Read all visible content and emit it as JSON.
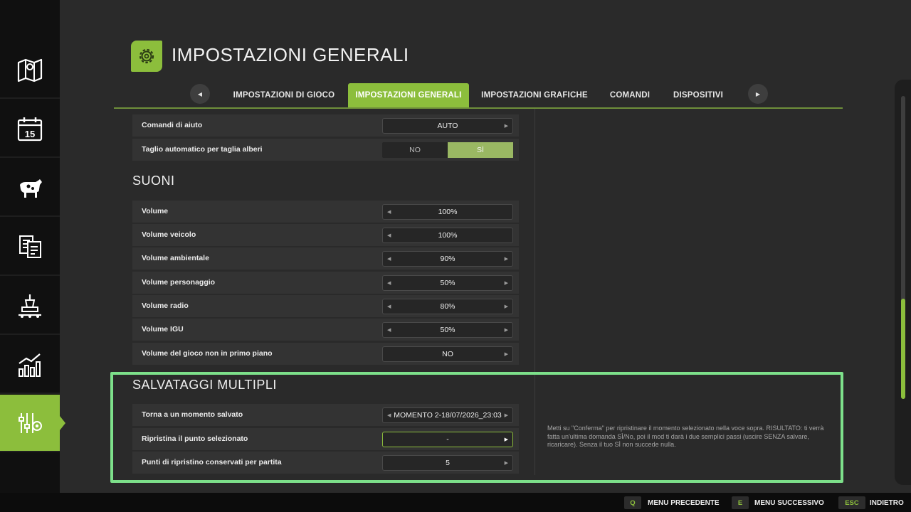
{
  "header": {
    "title": "IMPOSTAZIONI GENERALI"
  },
  "tabs": [
    {
      "label": "IMPOSTAZIONI DI GIOCO",
      "active": false
    },
    {
      "label": "IMPOSTAZIONI GENERALI",
      "active": true
    },
    {
      "label": "IMPOSTAZIONI GRAFICHE",
      "active": false
    },
    {
      "label": "COMANDI",
      "active": false
    },
    {
      "label": "DISPOSITIVI",
      "active": false
    }
  ],
  "sidebar": {
    "items": [
      {
        "icon": "map-icon"
      },
      {
        "icon": "calendar-icon",
        "day": "15"
      },
      {
        "icon": "cow-icon"
      },
      {
        "icon": "contracts-icon"
      },
      {
        "icon": "production-icon"
      },
      {
        "icon": "statistics-icon"
      },
      {
        "icon": "settings-icon",
        "active": true
      }
    ]
  },
  "settings": {
    "general": [
      {
        "label": "Comandi di aiuto",
        "value": "AUTO"
      },
      {
        "label": "Taglio automatico per taglia alberi",
        "options": [
          "NO",
          "SÌ"
        ],
        "selected": "SÌ"
      }
    ],
    "sounds": {
      "title": "SUONI",
      "rows": [
        {
          "label": "Volume",
          "value": "100%"
        },
        {
          "label": "Volume veicolo",
          "value": "100%"
        },
        {
          "label": "Volume ambientale",
          "value": "90%"
        },
        {
          "label": "Volume personaggio",
          "value": "50%"
        },
        {
          "label": "Volume radio",
          "value": "80%"
        },
        {
          "label": "Volume IGU",
          "value": "50%"
        },
        {
          "label": "Volume del gioco non in primo piano",
          "value": "NO"
        }
      ]
    },
    "saves": {
      "title": "SALVATAGGI MULTIPLI",
      "rows": [
        {
          "label": "Torna a un momento salvato",
          "value": "MOMENTO 2-18/07/2026_23:03"
        },
        {
          "label": "Ripristina il punto selezionato",
          "value": "-"
        },
        {
          "label": "Punti di ripristino conservati per partita",
          "value": "5"
        }
      ]
    }
  },
  "help_text": "Metti su \"Conferma\" per ripristinare il momento selezionato nella voce sopra. RISULTATO: ti verrà fatta un'ultima domanda SÌ/No, poi il mod ti darà i due semplici passi (uscire SENZA salvare, ricaricare). Senza il tuo SÌ non succede nulla.",
  "footer": [
    {
      "key": "Q",
      "label": "MENU PRECEDENTE"
    },
    {
      "key": "E",
      "label": "MENU SUCCESSIVO"
    },
    {
      "key": "ESC",
      "label": "INDIETRO"
    }
  ],
  "colors": {
    "accent": "#8cbe3c",
    "highlight": "#7de08a",
    "background": "#2a2a2a"
  },
  "scroll_position": 0.77
}
